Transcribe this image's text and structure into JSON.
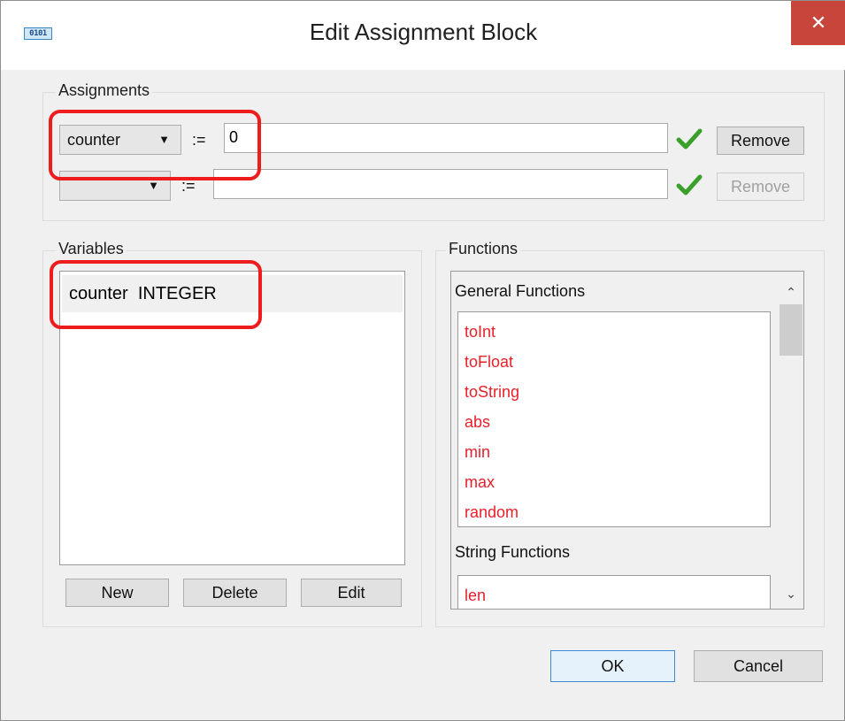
{
  "window": {
    "title": "Edit Assignment Block",
    "icon_text": "0101",
    "close_glyph": "✕"
  },
  "assignments": {
    "legend": "Assignments",
    "rows": [
      {
        "variable": "counter",
        "operator": ":=",
        "expression": "0",
        "remove_label": "Remove",
        "remove_enabled": true
      },
      {
        "variable": "",
        "operator": ":=",
        "expression": "",
        "remove_label": "Remove",
        "remove_enabled": false
      }
    ]
  },
  "variables": {
    "legend": "Variables",
    "items": [
      {
        "name": "counter",
        "type": "INTEGER"
      }
    ],
    "buttons": {
      "new": "New",
      "delete": "Delete",
      "edit": "Edit"
    }
  },
  "functions": {
    "legend": "Functions",
    "categories": [
      {
        "name": "General Functions",
        "items": [
          "toInt",
          "toFloat",
          "toString",
          "abs",
          "min",
          "max",
          "random"
        ]
      },
      {
        "name": "String Functions",
        "items": [
          "len"
        ]
      }
    ],
    "function_color": "#e8202a"
  },
  "dialog_buttons": {
    "ok": "OK",
    "cancel": "Cancel"
  },
  "annotation_color": "#ee1c1c"
}
